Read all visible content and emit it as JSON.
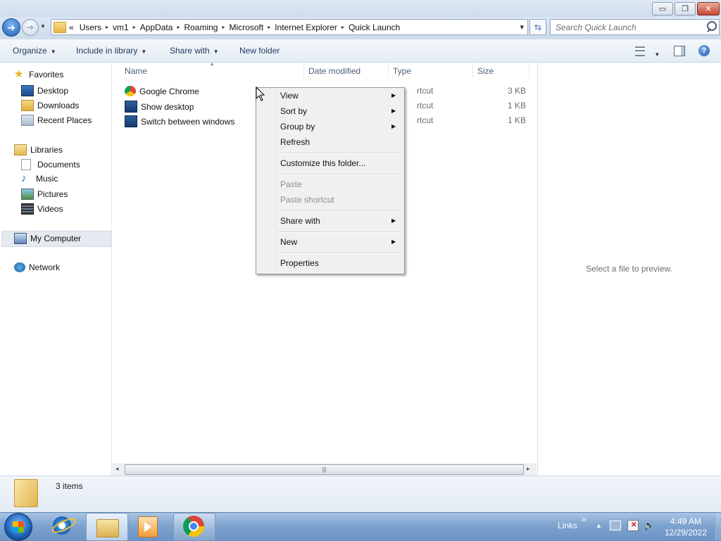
{
  "window": {
    "caption_buttons": {
      "minimize": "▭",
      "maximize": "❐",
      "close": "✕"
    }
  },
  "address_bar": {
    "overflow_glyph": "«",
    "crumbs": [
      "Users",
      "vm1",
      "AppData",
      "Roaming",
      "Microsoft",
      "Internet Explorer",
      "Quick Launch"
    ],
    "separator": "▸",
    "dropdown_glyph": "▾"
  },
  "search": {
    "placeholder": "Search Quick Launch"
  },
  "toolbar": {
    "organize": "Organize",
    "include_in_library": "Include in library",
    "share_with": "Share with",
    "new_folder": "New folder"
  },
  "nav": {
    "favorites": "Favorites",
    "desktop": "Desktop",
    "downloads": "Downloads",
    "recent_places": "Recent Places",
    "libraries": "Libraries",
    "documents": "Documents",
    "music": "Music",
    "pictures": "Pictures",
    "videos": "Videos",
    "my_computer": "My Computer",
    "network": "Network"
  },
  "columns": {
    "name": "Name",
    "date_modified": "Date modified",
    "type": "Type",
    "size": "Size"
  },
  "files": [
    {
      "name": "Google Chrome",
      "type": "rtcut",
      "size": "3 KB",
      "icon": "chrome-icon"
    },
    {
      "name": "Show desktop",
      "type": "rtcut",
      "size": "1 KB",
      "icon": "shortcut-icon"
    },
    {
      "name": "Switch between windows",
      "type": "rtcut",
      "size": "1 KB",
      "icon": "shortcut-icon"
    }
  ],
  "context_menu": {
    "view": "View",
    "sort_by": "Sort by",
    "group_by": "Group by",
    "refresh": "Refresh",
    "customize": "Customize this folder...",
    "paste": "Paste",
    "paste_shortcut": "Paste shortcut",
    "share_with": "Share with",
    "new": "New",
    "properties": "Properties"
  },
  "preview": {
    "text": "Select a file to preview."
  },
  "details": {
    "item_count": "3 items"
  },
  "taskbar": {
    "links": "Links",
    "overflow": "»",
    "time": "4:49 AM",
    "date": "12/29/2022"
  },
  "colors": {
    "accent": "#1d5fb8",
    "menu_bg": "#f0f0f0",
    "selected_nav_bg": "#e5eaf1"
  }
}
